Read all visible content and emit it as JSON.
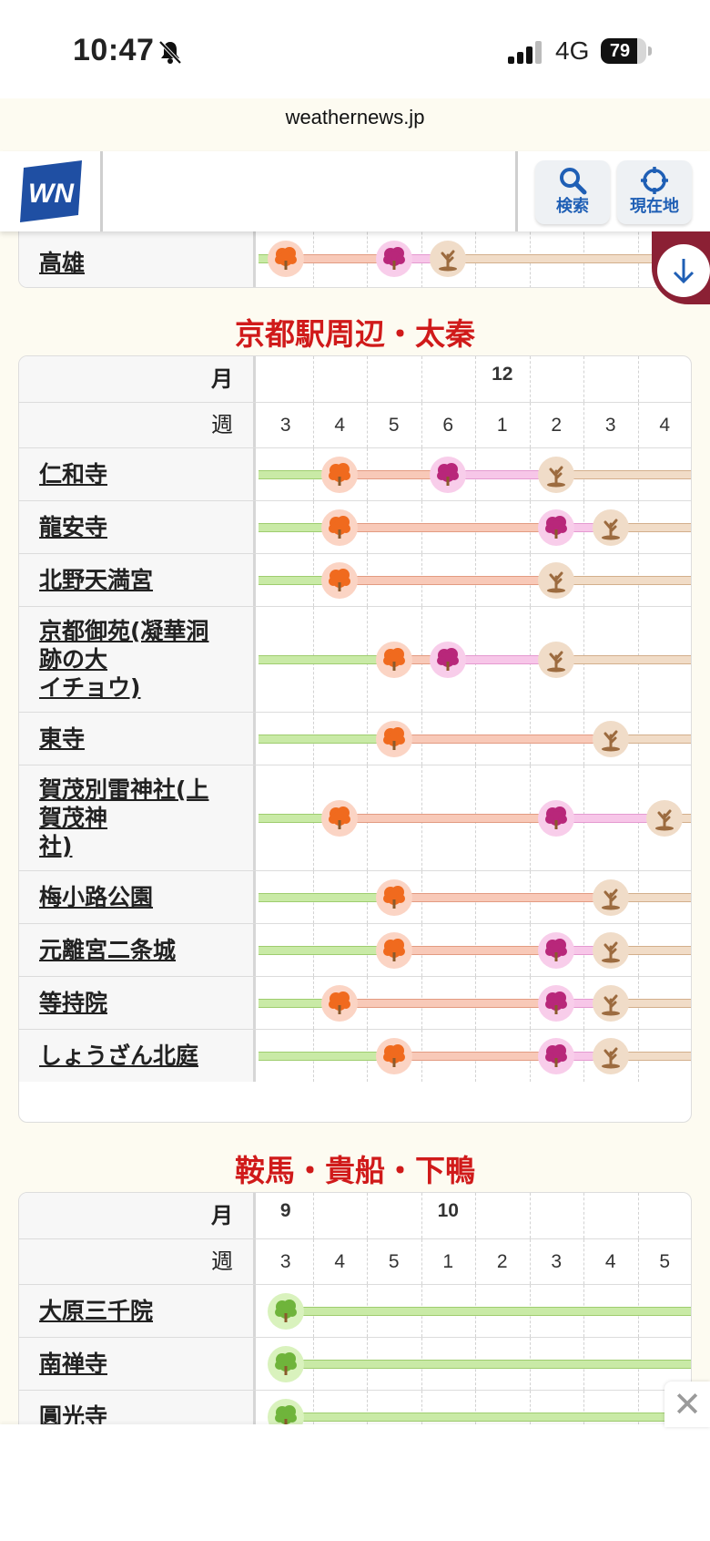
{
  "status": {
    "time": "10:47",
    "network": "4G",
    "battery": "79",
    "battery_level": 0.79,
    "url": "weathernews.jp"
  },
  "header": {
    "search_label": "検索",
    "location_label": "現在地"
  },
  "colors": {
    "green": "#c9eaa6",
    "orange": "#f8c9b8",
    "pink": "#f7c6e8",
    "brown": "#f1dcc7",
    "title_red": "#d01a1a",
    "download_tab": "#8b2034"
  },
  "top_row": {
    "name": "高雄"
  },
  "sections": [
    {
      "title": "京都駅周辺・太秦",
      "month_label": "月",
      "week_label": "週",
      "months": [
        "",
        "",
        "",
        "",
        "12",
        "",
        "",
        ""
      ],
      "weeks": [
        "3",
        "4",
        "5",
        "6",
        "1",
        "2",
        "3",
        "4"
      ],
      "rows": [
        {
          "name": "仁和寺"
        },
        {
          "name": "龍安寺"
        },
        {
          "name": "北野天満宮"
        },
        {
          "name": "京都御苑(凝華洞跡の大イチョウ)",
          "lines": [
            "京都御苑(凝華洞",
            "跡の大",
            "イチョウ)"
          ]
        },
        {
          "name": "東寺"
        },
        {
          "name": "賀茂別雷神社(上賀茂神社)",
          "lines": [
            "賀茂別雷神社(上",
            "賀茂神",
            "社)"
          ]
        },
        {
          "name": "梅小路公園"
        },
        {
          "name": "元離宮二条城"
        },
        {
          "name": "等持院"
        },
        {
          "name": "しょうざん北庭"
        }
      ]
    },
    {
      "title": "鞍馬・貴船・下鴨",
      "month_label": "月",
      "week_label": "週",
      "months": [
        "9",
        "",
        "",
        "10",
        "",
        "",
        "",
        ""
      ],
      "weeks": [
        "3",
        "4",
        "5",
        "1",
        "2",
        "3",
        "4",
        "5"
      ],
      "rows": [
        {
          "name": "大原三千院"
        },
        {
          "name": "南禅寺"
        },
        {
          "name": "圓光寺"
        }
      ]
    }
  ]
}
